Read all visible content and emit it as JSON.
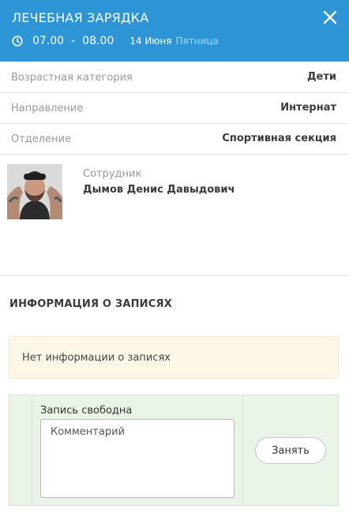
{
  "header": {
    "title": "ЛЕЧЕБНАЯ ЗАРЯДКА",
    "close_icon": "close-icon",
    "clock_icon": "clock-icon",
    "time_start": "07.00",
    "time_separator": "-",
    "time_end": "08.00",
    "date_day": "14 Июня",
    "date_weekday": "Пятница",
    "colors": {
      "background": "#2d94d6",
      "weekday": "#a9d7f5"
    }
  },
  "details": [
    {
      "label": "Возрастная категория",
      "value": "Дети"
    },
    {
      "label": "Направление",
      "value": "Интернат"
    },
    {
      "label": "Отделение",
      "value": "Спортивная секция"
    }
  ],
  "employee": {
    "label": "Сотрудник",
    "name": "Дымов Денис Давыдович",
    "photo_icon": "employee-photo"
  },
  "records": {
    "title": "ИНФОРМАЦИЯ О ЗАПИСЯХ",
    "empty_message": "Нет информации о записях",
    "colors": {
      "notice_bg": "#fcf7e6"
    }
  },
  "slot": {
    "status": "Запись свободна",
    "comment_placeholder": "Комментарий",
    "comment_value": "",
    "take_button": "Занять",
    "colors": {
      "background": "#ebf5e7"
    }
  }
}
